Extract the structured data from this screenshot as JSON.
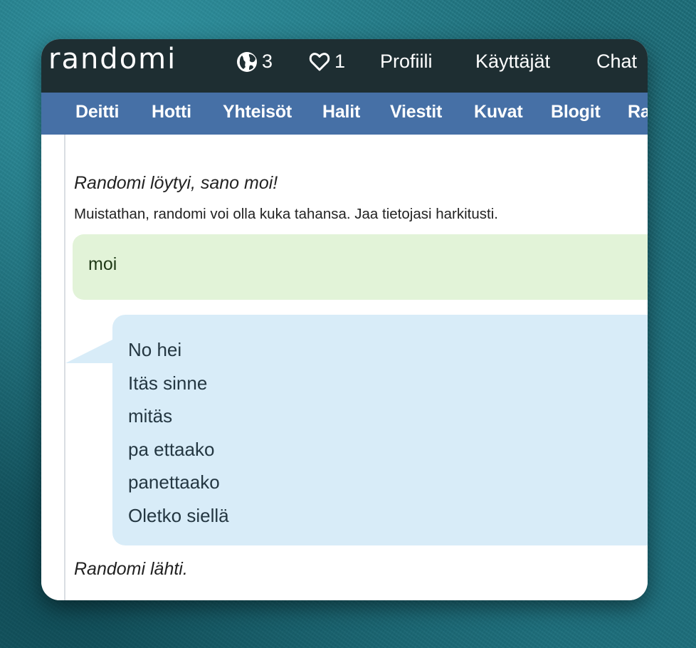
{
  "header": {
    "logo": "randomi",
    "online_count": "3",
    "likes_count": "1",
    "nav": [
      "Profiili",
      "Käyttäjät",
      "Chat"
    ]
  },
  "subnav": [
    "Deitti",
    "Hotti",
    "Yhteisöt",
    "Halit",
    "Viestit",
    "Kuvat",
    "Blogit",
    "Ra"
  ],
  "chat": {
    "found_text": "Randomi löytyi, sano moi!",
    "notice": "Muistathan, randomi voi olla kuka tahansa. Jaa tietojasi harkitusti.",
    "own_message": "moi",
    "partner_messages": [
      "No hei",
      "Itäs sinne",
      "mitäs",
      "pa ettaako",
      "panettaako",
      "Oletko siellä"
    ],
    "left_text": "Randomi lähti."
  },
  "colors": {
    "topbar": "#1e2e32",
    "subnav": "#4670a6",
    "own_bubble": "#e2f3d8",
    "partner_bubble": "#d8ecf8",
    "page_background": "#1c6e7a"
  },
  "icons": {
    "online": "globe-icon",
    "likes": "heart-outline-icon"
  }
}
